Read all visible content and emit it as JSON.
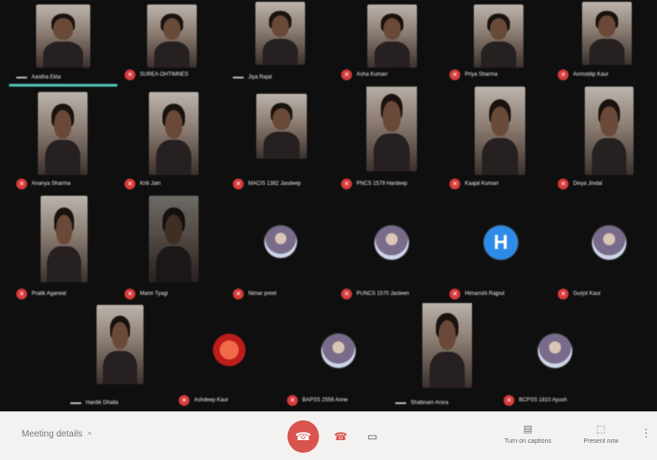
{
  "colors": {
    "muted_mic": "#d93d3d",
    "speaking_indicator": "#4fc3b4",
    "end_call": "#d9534f",
    "avatar_blue": "#2e8be8"
  },
  "participants": [
    {
      "name": "Aastha Ekta",
      "kind": "video"
    },
    {
      "name": "SUREA OHTIMNES",
      "kind": "video"
    },
    {
      "name": "Jiya Rajat",
      "kind": "video"
    },
    {
      "name": "Asha Kumari",
      "kind": "video"
    },
    {
      "name": "Priya Sharma",
      "kind": "video"
    },
    {
      "name": "Anmoldip Kaur",
      "kind": "video"
    },
    {
      "name": "Ananya Sharma",
      "kind": "video"
    },
    {
      "name": "Kriti Jain",
      "kind": "video"
    },
    {
      "name": "MACIS 1382 Jasdeep",
      "kind": "video"
    },
    {
      "name": "PNCS 1579 Hardeep",
      "kind": "video"
    },
    {
      "name": "Kaajal Kumari",
      "kind": "video"
    },
    {
      "name": "Divya Jindal",
      "kind": "video"
    },
    {
      "name": "Pratik Agarwal",
      "kind": "video"
    },
    {
      "name": "Mann Tyagi",
      "kind": "video"
    },
    {
      "name": "Nimar preet",
      "kind": "avatar"
    },
    {
      "name": "PUNCS 1570 Jasleen",
      "kind": "avatar"
    },
    {
      "name": "Himanshi Rajput",
      "kind": "avatar",
      "initial": "H"
    },
    {
      "name": "Gurjot Kaur",
      "kind": "avatar"
    },
    {
      "name": "Hardik Dhalla",
      "kind": "video"
    },
    {
      "name": "Ashdeep Kaur",
      "kind": "avatar"
    },
    {
      "name": "BAPSS 2556 Anne",
      "kind": "avatar"
    },
    {
      "name": "Shabnam Arora",
      "kind": "video"
    },
    {
      "name": "BCPSS 1810 Ayush",
      "kind": "avatar"
    }
  ],
  "bottom_bar": {
    "meeting_details": "Meeting details",
    "end_call_icon": "phone-end-icon",
    "turn_on_captions": "Turn on captions",
    "present_now": "Present now"
  }
}
